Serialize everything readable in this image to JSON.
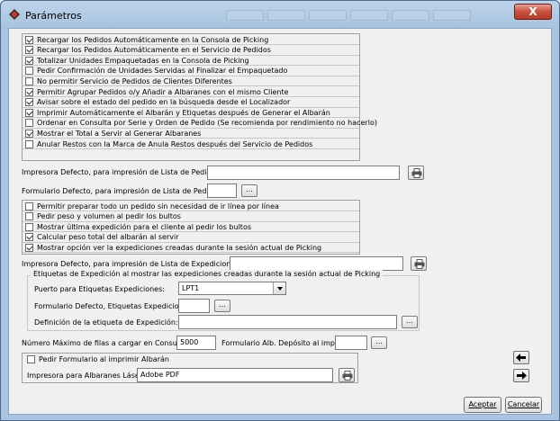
{
  "window": {
    "title": "Parámetros",
    "close_label": "X"
  },
  "top_checks": [
    {
      "label": "Recargar los Pedidos Automáticamente en la Consola de Picking",
      "checked": true
    },
    {
      "label": "Recargar los Pedidos Automáticamente en el Servicio de Pedidos",
      "checked": true
    },
    {
      "label": "Totalizar Unidades Empaquetadas en la Consola de Picking",
      "checked": true
    },
    {
      "label": "Pedir Confirmación de Unidades Servidas al Finalizar el Empaquetado",
      "checked": false
    },
    {
      "label": "No permitir Servicio de Pedidos de Clientes Diferentes",
      "checked": false
    },
    {
      "label": "Permitir Agrupar Pedidos o/y  Añadir a Albaranes con el mismo Cliente",
      "checked": true
    },
    {
      "label": "Avisar sobre el estado del pedido en la búsqueda desde el Localizador",
      "checked": true
    },
    {
      "label": "Imprimir Automáticamente el Albarán y Etiquetas después de Generar el Albarán",
      "checked": true
    },
    {
      "label": "Ordenar en Consulta por Serie y Orden de Pedido (Se recomienda por rendimiento no hacerlo)",
      "checked": false
    },
    {
      "label": "Mostrar el Total a Servir al Generar Albaranes",
      "checked": true
    },
    {
      "label": "Anular Restos con la Marca de Anula Restos después del Servicio de Pedidos",
      "checked": false
    }
  ],
  "printer_lista": {
    "label": "Impresora Defecto, para impresión de Lista de Pedidos",
    "value": ""
  },
  "form_lista": {
    "label": "Formulario Defecto, para impresión de Lista de Pedidos",
    "value": "",
    "button": "..."
  },
  "mid_checks": [
    {
      "label": "Permitir preparar todo un pedido sin necesidad de ir línea por línea",
      "checked": false
    },
    {
      "label": "Pedir peso y volumen al pedir los bultos",
      "checked": false
    },
    {
      "label": "Mostrar última expedición para el cliente al pedir los bultos",
      "checked": false
    },
    {
      "label": "Calcular peso total del albarán al servir",
      "checked": true
    },
    {
      "label": "Mostrar opción ver la expediciones creadas durante la sesión actual de Picking",
      "checked": true
    }
  ],
  "printer_exped": {
    "label": "Impresora Defecto, para impresión de Lista de Expediciones",
    "value": ""
  },
  "etiquetas": {
    "legend": "Etiquetas de Expedición al mostrar las expediciones creadas durante la sesión actual de Picking",
    "puerto_label": "Puerto para Etiquetas Expediciones:",
    "puerto_value": "LPT1",
    "form_label": "Formulario Defecto, Etiquetas Expediciones:",
    "form_value": "",
    "def_label": "Definición de la etiqueta de Expedición:",
    "def_value": "",
    "button": "..."
  },
  "max_filas": {
    "label": "Número Máximo de filas a cargar en Consultas",
    "value": "5000"
  },
  "form_alb": {
    "label": "Formulario Alb. Depósito al imprimir",
    "value": "",
    "button": "..."
  },
  "bottom": {
    "pedir_label": "Pedir Formulario al imprimir Albarán",
    "pedir_checked": false,
    "impresora_label": "Impresora para Albaranes Láser",
    "impresora_value": "Adobe PDF"
  },
  "buttons": {
    "accept": "Aceptar",
    "cancel": "Cancelar"
  }
}
